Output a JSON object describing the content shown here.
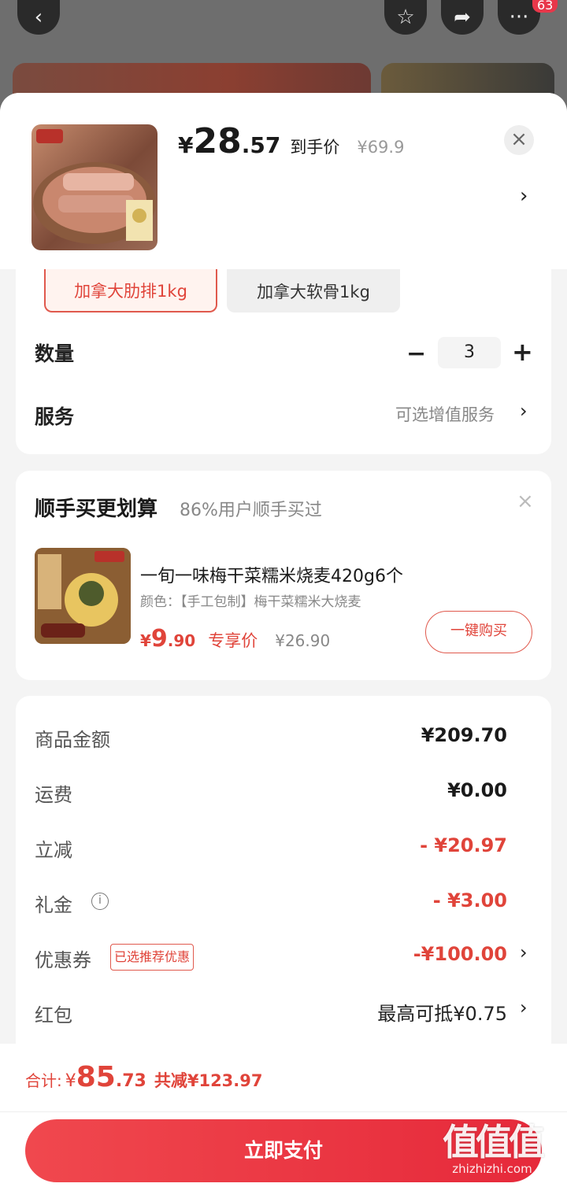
{
  "background": {
    "notification_count": "63"
  },
  "product": {
    "price_yen": "¥",
    "price_int": "28",
    "price_dec": ".57",
    "price_label": "到手价",
    "original_price": "¥69.9"
  },
  "specs": {
    "options": [
      "加拿大肋排1kg",
      "加拿大软骨1kg"
    ],
    "selected_index": 0
  },
  "quantity": {
    "label": "数量",
    "value": "3"
  },
  "service": {
    "label": "服务",
    "value": "可选增值服务"
  },
  "upsell": {
    "title": "顺手买更划算",
    "subtitle": "86%用户顺手买过",
    "name": "一旬一味梅干菜糯米烧麦420g6个",
    "color": "颜色：【手工包制】梅干菜糯米大烧麦",
    "price_yen": "¥",
    "price_int": "9",
    "price_dec": ".90",
    "price_label": "专享价",
    "original_price": "¥26.90",
    "buy_label": "一键购买"
  },
  "summary": {
    "goods_label": "商品金额",
    "goods_value": "¥209.70",
    "shipping_label": "运费",
    "shipping_value": "¥0.00",
    "discount_label": "立减",
    "discount_value": "- ¥20.97",
    "gift_label": "礼金",
    "gift_value": "- ¥3.00",
    "coupon_label": "优惠券",
    "coupon_tag": "已选推荐优惠",
    "coupon_value": "-¥100.00",
    "redpacket_label": "红包",
    "redpacket_value": "最高可抵¥0.75"
  },
  "footer": {
    "total_label": "合计:",
    "total_yen": "¥",
    "total_int": "85",
    "total_dec": ".73",
    "total_saved": "共减¥123.97",
    "pay_label": "立即支付"
  },
  "watermark": {
    "big": "值值值",
    "site": "zhizhizhi.com"
  },
  "colors": {
    "accent": "#e0443a",
    "pay_button": "#e6293a"
  }
}
